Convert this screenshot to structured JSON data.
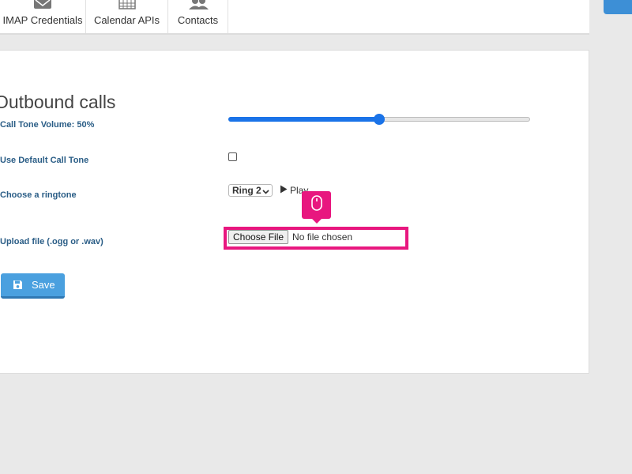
{
  "tabs": [
    {
      "label": "IMAP Credentials",
      "icon": "envelope-icon"
    },
    {
      "label": "Calendar APIs",
      "icon": "calendar-icon"
    },
    {
      "label": "Contacts",
      "icon": "contacts-icon"
    }
  ],
  "section": {
    "title": "Outbound calls"
  },
  "fields": {
    "volume_label": "Call Tone Volume: 50%",
    "volume_value_percent": 50,
    "default_tone_label": "Use Default Call Tone",
    "default_tone_checked": false,
    "ringtone_label": "Choose a ringtone",
    "ringtone_selected": "Ring 2",
    "play_label": "Play",
    "upload_label": "Upload file (.ogg or .wav)",
    "choose_file_label": "Choose File",
    "no_file_label": "No file chosen"
  },
  "save": {
    "label": "Save"
  },
  "colors": {
    "accent": "#1a73e8",
    "highlight": "#e8177f",
    "label": "#2a5d86",
    "save_button": "#4aa0df"
  }
}
